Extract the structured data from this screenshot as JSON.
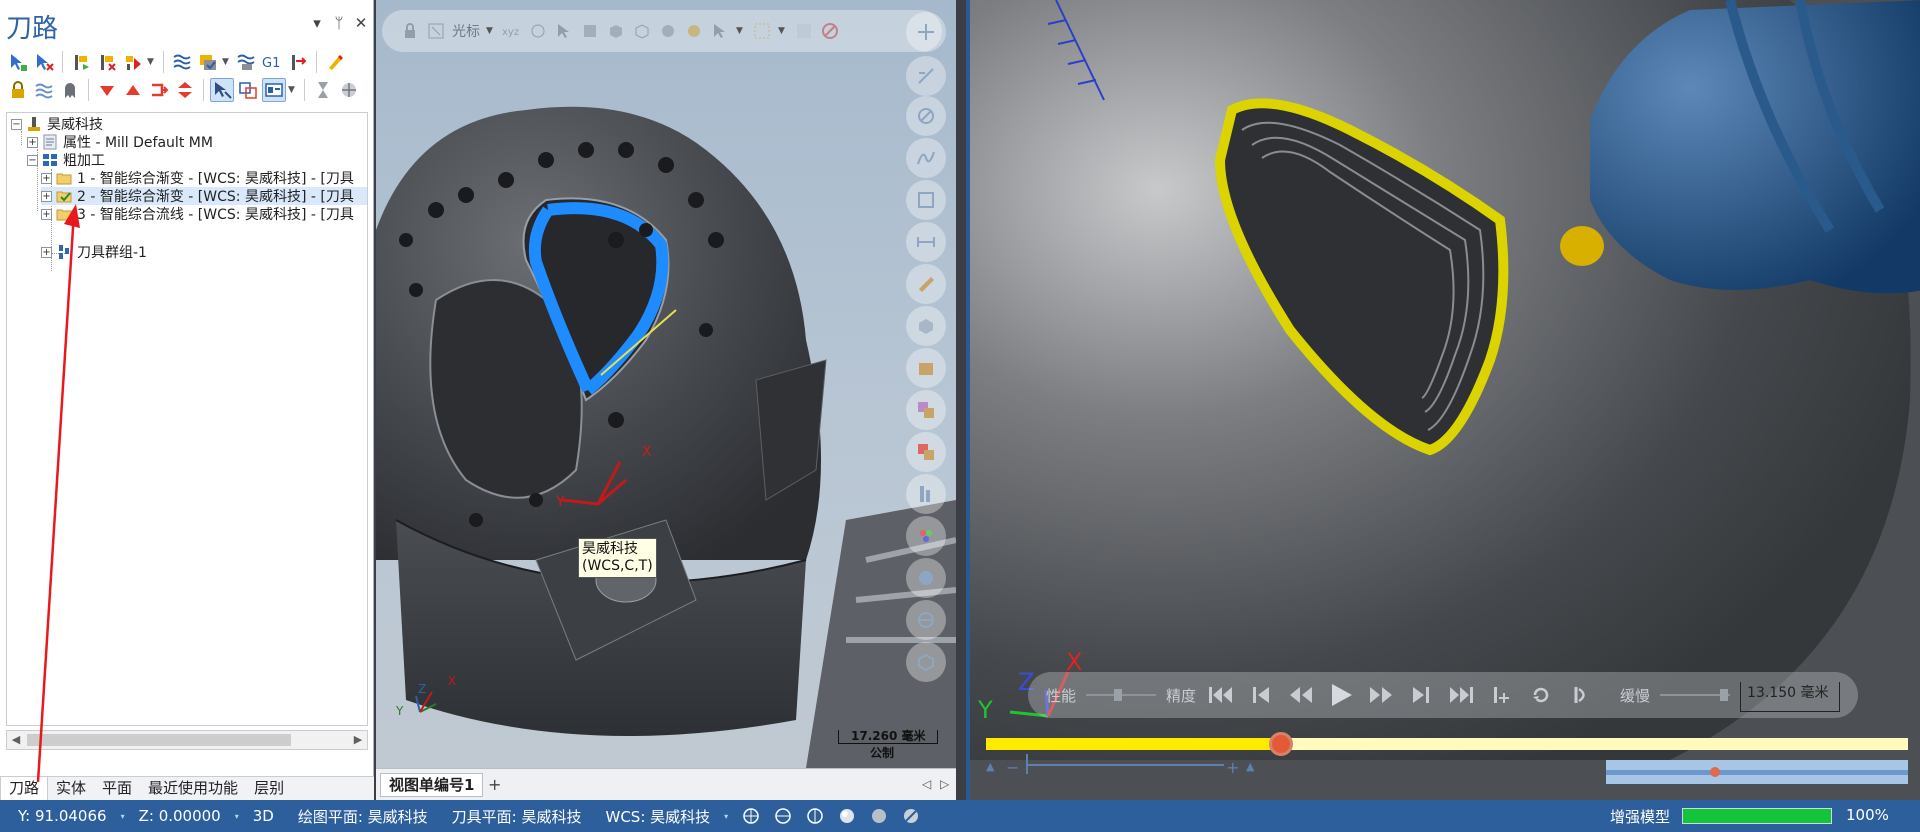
{
  "panel": {
    "title": "刀路",
    "title_buttons": [
      "▾",
      "ᛘ",
      "✕"
    ],
    "tree": {
      "root": "昊威科技",
      "properties": "属性 - Mill Default MM",
      "group": "粗加工",
      "ops": [
        "1 - 智能综合渐变 - [WCS: 昊威科技] - [刀具",
        "2 - 智能综合渐变 - [WCS: 昊威科技] - [刀具",
        "3 - 智能综合流线 - [WCS: 昊威科技] - [刀具"
      ],
      "tool_group": "刀具群组-1",
      "selected_index": 1
    },
    "bottom_tabs": [
      "刀路",
      "实体",
      "平面",
      "最近使用功能",
      "层别"
    ],
    "active_tab": 0
  },
  "viewport": {
    "toolbar_label": "光标",
    "wcs_label_line1": "昊威科技",
    "wcs_label_line2": "(WCS,C,T)",
    "scale_value": "17.260 毫米",
    "scale_unit": "公制",
    "tab_label": "视图单编号1",
    "tab_add": "+",
    "tab_nav": [
      "◁",
      "▷"
    ],
    "axis_x": "X",
    "axis_y": "Y",
    "axis_z": "Z"
  },
  "simulator": {
    "label_performance": "性能",
    "label_precision": "精度",
    "label_slow": "缓慢",
    "scale_value": "13.150 毫米",
    "progress": 0.32,
    "range_minus": "−",
    "range_plus": "+",
    "axis_x": "X",
    "axis_y": "Y",
    "axis_z": "Z"
  },
  "status": {
    "y": "Y:  91.04066",
    "z": "Z:  0.00000",
    "mode": "3D",
    "draw_plane": "绘图平面: 昊威科技",
    "tool_plane": "刀具平面: 昊威科技",
    "wcs": "WCS: 昊威科技",
    "enhanced_model": "增强模型",
    "enhanced_pct_value": 1.0,
    "enhanced_pct": "100%"
  },
  "colors": {
    "accent": "#2e5f9d",
    "toolpath_highlight": "#1e8cff",
    "sim_path": "#e8e000",
    "progress_knob": "#e45a36",
    "annotation_arrow": "#e8191e"
  }
}
